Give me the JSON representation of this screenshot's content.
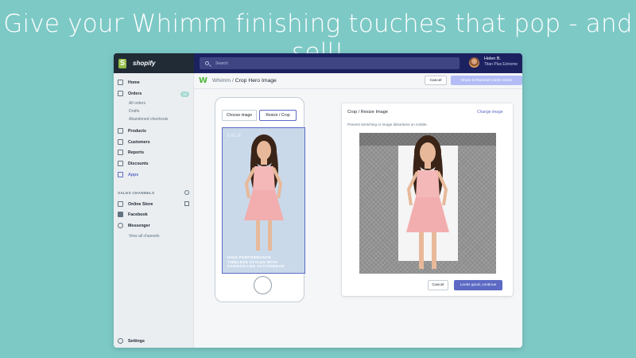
{
  "headline": "Give your Whimm finishing touches that pop - and sell!",
  "topbar": {
    "brand": "shopify",
    "search_placeholder": "Search",
    "user_name": "Helen B.",
    "user_plan": "Titan Plus Extreme"
  },
  "sidebar": {
    "items": [
      {
        "label": "Home",
        "icon": "home-icon"
      },
      {
        "label": "Orders",
        "icon": "orders-icon"
      },
      {
        "label": "Products",
        "icon": "products-icon"
      },
      {
        "label": "Customers",
        "icon": "customers-icon"
      },
      {
        "label": "Reports",
        "icon": "reports-icon"
      },
      {
        "label": "Discounts",
        "icon": "discounts-icon"
      },
      {
        "label": "Apps",
        "icon": "apps-icon"
      }
    ],
    "orders_badge": "12",
    "order_subitems": [
      "All orders",
      "Drafts",
      "Abandoned checkouts"
    ],
    "sales_channels_heading": "SALES CHANNELS",
    "channels": [
      {
        "label": "Online Store",
        "icon": "store-icon"
      },
      {
        "label": "Facebook",
        "icon": "facebook-icon"
      },
      {
        "label": "Messenger",
        "icon": "messenger-icon"
      }
    ],
    "view_all": "View all channels",
    "settings": "Settings"
  },
  "header": {
    "app_logo": "W",
    "breadcrumb_parent": "Whimm /",
    "breadcrumb_current": "Crop Hero Image",
    "cancel": "Cancel",
    "share": "Share Enhanced Cards Action"
  },
  "phone": {
    "tab_choose": "Choose image",
    "tab_resize": "Resize / Crop",
    "screen_tag": "SALE",
    "caption_line1": "HIGH PERFORMANCE",
    "caption_line2": "TIMELESS STYLES WITH",
    "caption_line3": "FASHION-LED ACTIVEWEAR"
  },
  "crop_card": {
    "title": "Crop / Resize Image",
    "change_link": "Change image",
    "description": "Prevent stretching or image distortions on mobile.",
    "cancel": "Cancel",
    "continue": "Looks good, continue"
  },
  "colors": {
    "background": "#7dc9c6",
    "topbar": "#1c2260",
    "accent": "#5c6ac4",
    "dress": "#f4b8b8"
  }
}
